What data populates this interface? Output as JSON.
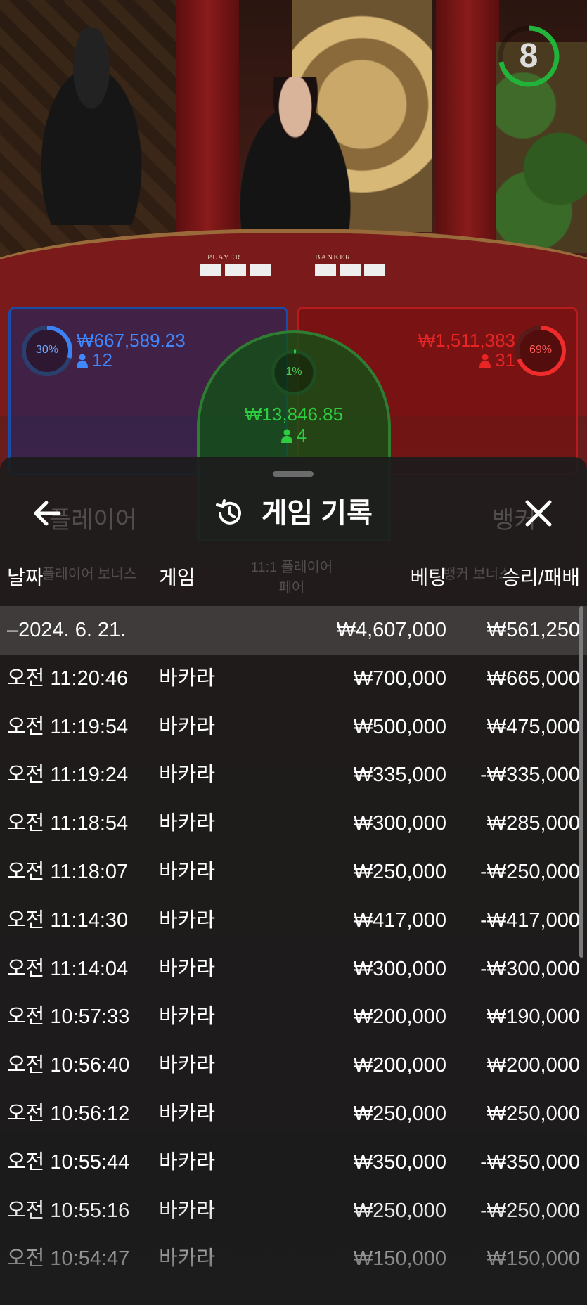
{
  "timer": {
    "value": "8"
  },
  "spots": {
    "player": {
      "percent": "30%",
      "amount": "₩667,589.23",
      "count": "12"
    },
    "tie": {
      "percent": "1%",
      "amount": "₩13,846.85",
      "count": "4"
    },
    "banker": {
      "percent": "69%",
      "amount": "₩1,511,383",
      "count": "31"
    }
  },
  "table_labels": {
    "player": "PLAYER",
    "banker": "BANKER"
  },
  "modal": {
    "title": "게임 기록",
    "columns": {
      "date": "날짜",
      "game": "게임",
      "bet": "베팅",
      "win": "승리/패배"
    },
    "summary": {
      "date": "–2024. 6. 21.",
      "bet": "₩4,607,000",
      "win": "₩561,250"
    },
    "rows": [
      {
        "date": "오전 11:20:46",
        "game": "바카라",
        "bet": "₩700,000",
        "win": "₩665,000"
      },
      {
        "date": "오전 11:19:54",
        "game": "바카라",
        "bet": "₩500,000",
        "win": "₩475,000"
      },
      {
        "date": "오전 11:19:24",
        "game": "바카라",
        "bet": "₩335,000",
        "win": "-₩335,000"
      },
      {
        "date": "오전 11:18:54",
        "game": "바카라",
        "bet": "₩300,000",
        "win": "₩285,000"
      },
      {
        "date": "오전 11:18:07",
        "game": "바카라",
        "bet": "₩250,000",
        "win": "-₩250,000"
      },
      {
        "date": "오전 11:14:30",
        "game": "바카라",
        "bet": "₩417,000",
        "win": "-₩417,000"
      },
      {
        "date": "오전 11:14:04",
        "game": "바카라",
        "bet": "₩300,000",
        "win": "-₩300,000"
      },
      {
        "date": "오전 10:57:33",
        "game": "바카라",
        "bet": "₩200,000",
        "win": "₩190,000"
      },
      {
        "date": "오전 10:56:40",
        "game": "바카라",
        "bet": "₩200,000",
        "win": "₩200,000"
      },
      {
        "date": "오전 10:56:12",
        "game": "바카라",
        "bet": "₩250,000",
        "win": "₩250,000"
      },
      {
        "date": "오전 10:55:44",
        "game": "바카라",
        "bet": "₩350,000",
        "win": "-₩350,000"
      },
      {
        "date": "오전 10:55:16",
        "game": "바카라",
        "bet": "₩250,000",
        "win": "-₩250,000"
      },
      {
        "date": "오전 10:54:47",
        "game": "바카라",
        "bet": "₩150,000",
        "win": "₩150,000"
      }
    ]
  },
  "background_ghost": {
    "player": "플레이어",
    "banker": "뱅커",
    "player_bonus": "플레이어 보너스",
    "player_pair": "11:1 플레이어 페어",
    "banker_bonus": "뱅커 보너스"
  },
  "colors": {
    "player_blue": "#3b82f6",
    "banker_red": "#ef2b2b",
    "tie_green": "#2ecc40",
    "timer_green": "#22b33a"
  }
}
